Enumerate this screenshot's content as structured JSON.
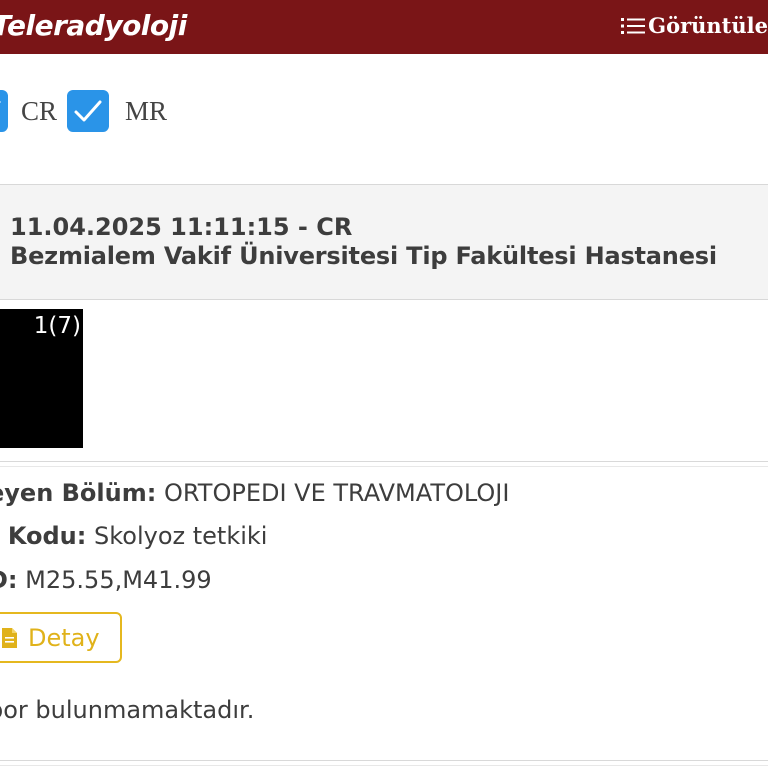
{
  "header": {
    "brand": "Teleradyoloji",
    "menu_label": "Görüntüle",
    "menu_icon": "list-icon",
    "background": "#7a1517"
  },
  "filters": {
    "items": [
      {
        "label": "CR",
        "checked": true
      },
      {
        "label": "MR",
        "checked": true
      }
    ],
    "check_color": "#2a94e8"
  },
  "study": {
    "datetime_modality": "11.04.2025 11:11:15 - CR",
    "hospital": "Bezmialem Vakif Üniversitesi Tip Fakültesi Hastanesi",
    "thumbnail_count": "1(7)"
  },
  "details": {
    "department_label": "eyen Bölüm:",
    "department_value": "ORTOPEDI VE TRAVMATOLOJI",
    "code_label": "t Kodu:",
    "code_value": "Skolyoz tetkiki",
    "icd_label": "D:",
    "icd_value": "M25.55,M41.99",
    "detail_button": "Detay",
    "detail_icon": "document-icon",
    "report_status": "por bulunmamaktadır."
  }
}
